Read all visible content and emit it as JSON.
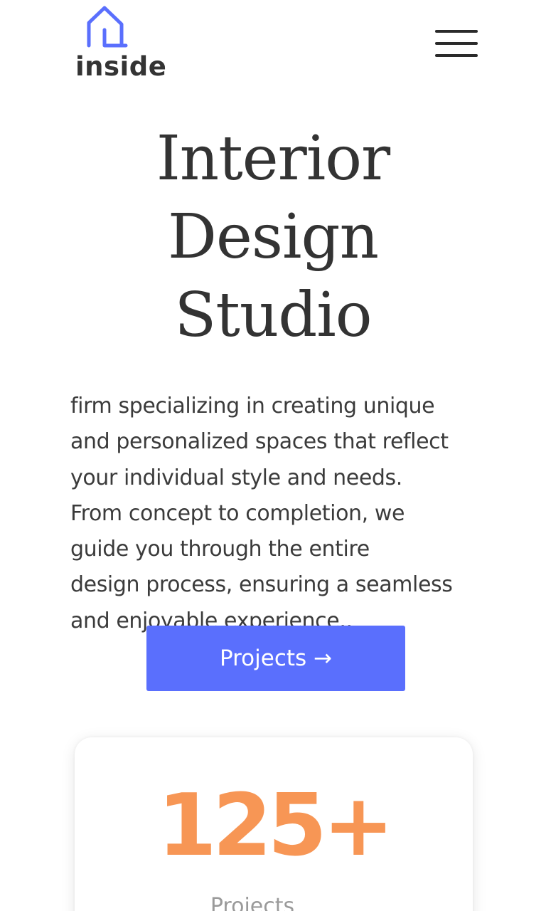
{
  "header": {
    "logo_text": "inside",
    "logo_icon": "house-outline-icon",
    "menu_icon": "hamburger-menu-icon"
  },
  "hero": {
    "title_lines": [
      "Interior",
      "Design",
      "Studio"
    ],
    "description_lines": [
      "firm specializing in creating unique",
      "and personalized spaces that reflect",
      "your individual style and needs.",
      "From concept to completion, we",
      "guide you through the entire",
      "design process, ensuring a seamless",
      "and enjoyable experience.."
    ],
    "cta_label": "Projects →"
  },
  "stats": {
    "count": "125+",
    "label": "Projects"
  },
  "colors": {
    "accent": "#5a6ffd",
    "stat": "#f79655",
    "text": "#333333"
  }
}
